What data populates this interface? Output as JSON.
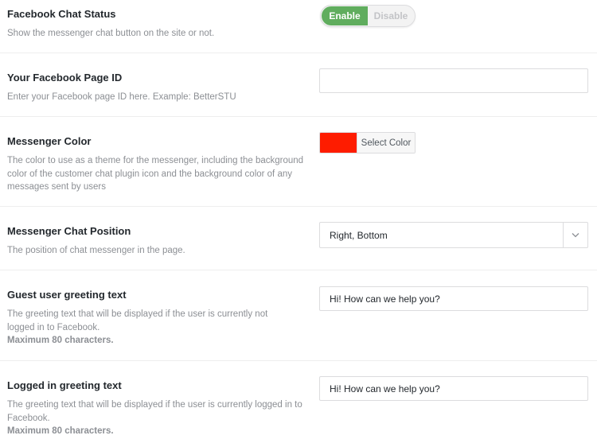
{
  "settings": [
    {
      "title": "Facebook Chat Status",
      "description": "Show the messenger chat button on the site or not.",
      "toggle": {
        "on_label": "Enable",
        "off_label": "Disable",
        "selected": "Enable"
      }
    },
    {
      "title": "Your Facebook Page ID",
      "description": "Enter your Facebook page ID here. Example: BetterSTU",
      "input": {
        "value": ""
      }
    },
    {
      "title": "Messenger Color",
      "description": "The color to use as a theme for the messenger, including the background color of the customer chat plugin icon and the background color of any messages sent by users",
      "color": {
        "value": "#fe1c00",
        "button_label": "Select Color"
      }
    },
    {
      "title": "Messenger Chat Position",
      "description": "The position of chat messenger in the page.",
      "select": {
        "value": "Right, Bottom"
      }
    },
    {
      "title": "Guest user greeting text",
      "description": "The greeting text that will be displayed if the user is currently not logged in to Facebook.",
      "note": "Maximum 80 characters.",
      "input": {
        "value": "Hi! How can we help you?"
      }
    },
    {
      "title": "Logged in greeting text",
      "description": "The greeting text that will be displayed if the user is currently logged in to Facebook.",
      "note": "Maximum 80 characters.",
      "input": {
        "value": "Hi! How can we help you?"
      }
    }
  ],
  "colors": {
    "enable_green": "#60ad5e",
    "messenger_color": "#fe1c00"
  },
  "icons": {
    "select_arrow": "chevron-down-icon"
  }
}
